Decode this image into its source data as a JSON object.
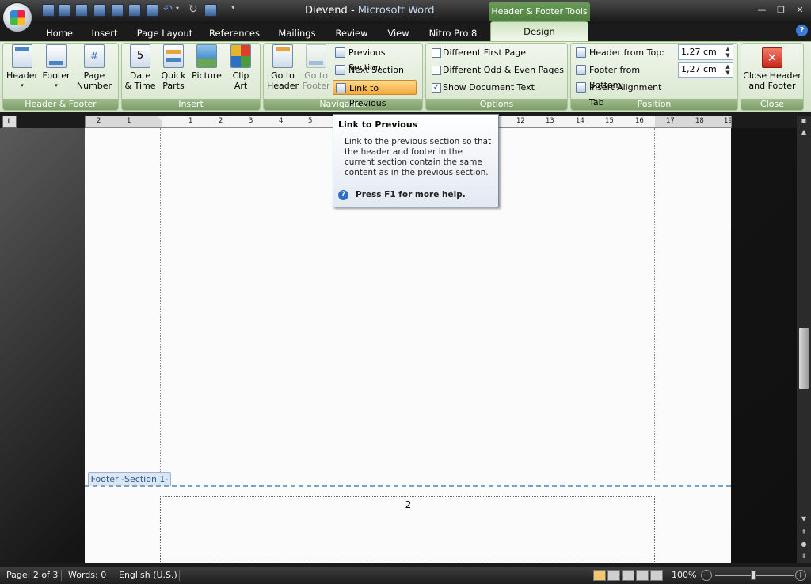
{
  "titlebar": {
    "document": "Dievend",
    "separator": " - ",
    "app": "Microsoft Word",
    "context_tab_title": "Header & Footer Tools"
  },
  "tabs": [
    "Home",
    "Insert",
    "Page Layout",
    "References",
    "Mailings",
    "Review",
    "View",
    "Nitro Pro 8"
  ],
  "active_tab": "Design",
  "groups": {
    "header_footer": {
      "label": "Header & Footer",
      "header": "Header",
      "footer": "Footer",
      "page_number": "Page\nNumber"
    },
    "insert": {
      "label": "Insert",
      "date_time_1": "Date",
      "date_time_2": "& Time",
      "quick_parts_1": "Quick",
      "quick_parts_2": "Parts",
      "picture": "Picture",
      "clip_art_1": "Clip",
      "clip_art_2": "Art"
    },
    "navigation": {
      "label": "Navigation",
      "go_header_1": "Go to",
      "go_header_2": "Header",
      "go_footer_1": "Go to",
      "go_footer_2": "Footer",
      "previous_section": "Previous Section",
      "next_section": "Next Section",
      "link_to_previous": "Link to Previous"
    },
    "options": {
      "label": "Options",
      "diff_first": "Different First Page",
      "diff_odd_even": "Different Odd & Even Pages",
      "show_doc_text": "Show Document Text",
      "diff_first_checked": false,
      "diff_odd_even_checked": false,
      "show_doc_text_checked": true
    },
    "position": {
      "label": "Position",
      "header_from_top": "Header from Top:",
      "header_value": "1,27 cm",
      "footer_from_bottom": "Footer from Bottom:",
      "footer_value": "1,27 cm",
      "insert_alignment_tab": "Insert Alignment Tab"
    },
    "close": {
      "label": "Close",
      "close_1": "Close Header",
      "close_2": "and Footer"
    }
  },
  "ruler": {
    "ticks": [
      "2",
      "1",
      "1",
      "2",
      "3",
      "4",
      "5",
      "12",
      "13",
      "14",
      "15",
      "16",
      "17",
      "18",
      "19"
    ]
  },
  "tooltip": {
    "title": "Link to Previous",
    "line1": "Link to the previous section so that",
    "line2": "the header and footer in the",
    "line3": "current section contain the same",
    "line4": "content as in the previous section.",
    "help": "Press F1 for more help."
  },
  "document": {
    "footer_tag": "Footer -Section 1-",
    "page_number": "2"
  },
  "statusbar": {
    "page": "Page: 2 of 3",
    "words": "Words: 0",
    "language": "English (U.S.)",
    "zoom": "100%"
  },
  "colors": {
    "ribbon_green": "#dce9d3",
    "context_tab": "#6a9b58",
    "link_active": "#f6a83b"
  }
}
